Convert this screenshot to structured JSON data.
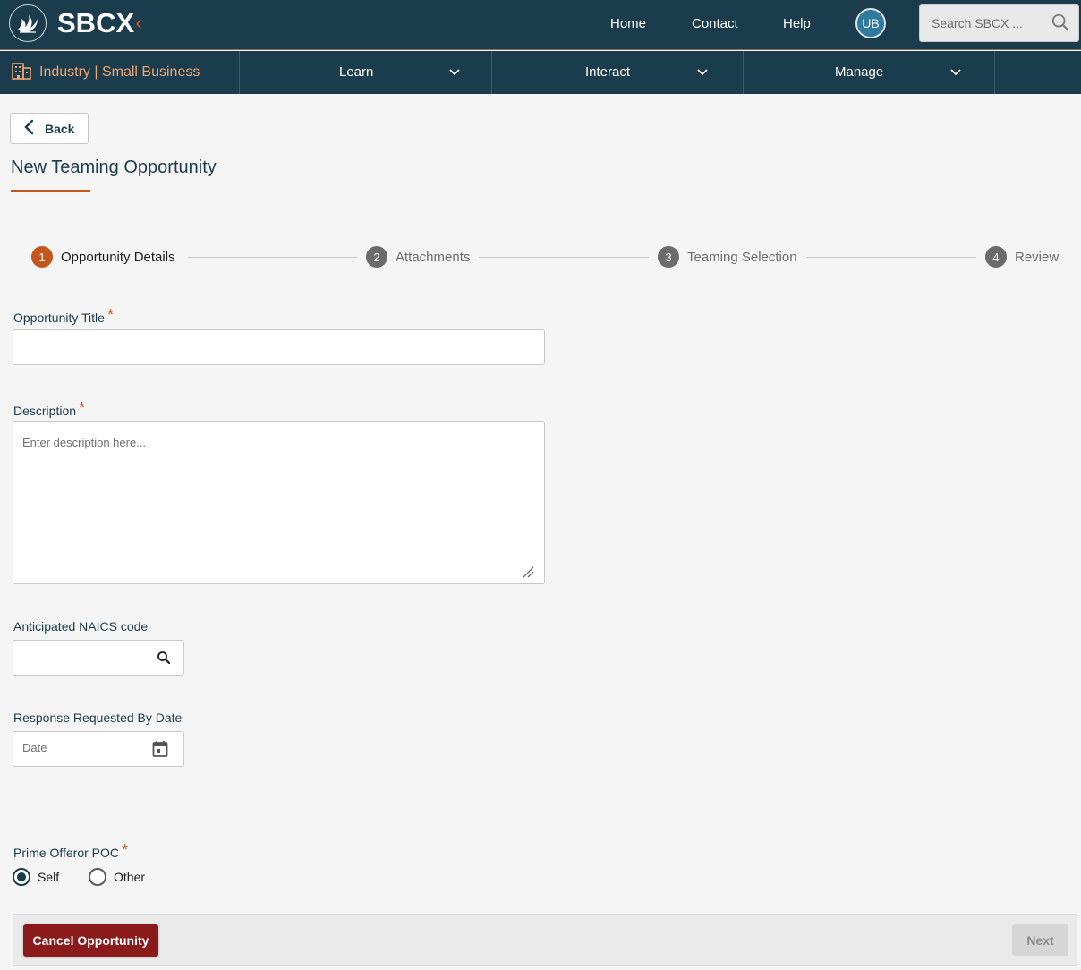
{
  "header": {
    "logo_text": "SBCX",
    "nav": [
      "Home",
      "Contact",
      "Help"
    ],
    "avatar_initials": "UB",
    "search_placeholder": "Search SBCX ..."
  },
  "subnav": {
    "org_label": "Industry | Small Business",
    "items": [
      "Learn",
      "Interact",
      "Manage"
    ]
  },
  "page": {
    "back_label": "Back",
    "title": "New Teaming Opportunity"
  },
  "stepper": {
    "steps": [
      {
        "number": "1",
        "label": "Opportunity Details",
        "active": true
      },
      {
        "number": "2",
        "label": "Attachments",
        "active": false
      },
      {
        "number": "3",
        "label": "Teaming Selection",
        "active": false
      },
      {
        "number": "4",
        "label": "Review",
        "active": false
      }
    ]
  },
  "form": {
    "title_label": "Opportunity Title",
    "title_value": "",
    "required_mark": "*",
    "description_label": "Description",
    "description_placeholder": "Enter description here...",
    "naics_label": "Anticipated NAICS code",
    "naics_value": "",
    "date_label": "Response Requested By Date",
    "date_placeholder": "Date",
    "poc_label": "Prime Offeror POC",
    "poc_options": [
      "Self",
      "Other"
    ],
    "poc_selected": "Self"
  },
  "footer": {
    "cancel_label": "Cancel Opportunity",
    "next_label": "Next"
  },
  "colors": {
    "header_bg": "#1a3c4d",
    "accent": "#c4561e",
    "cancel_bg": "#8b1a1a"
  }
}
